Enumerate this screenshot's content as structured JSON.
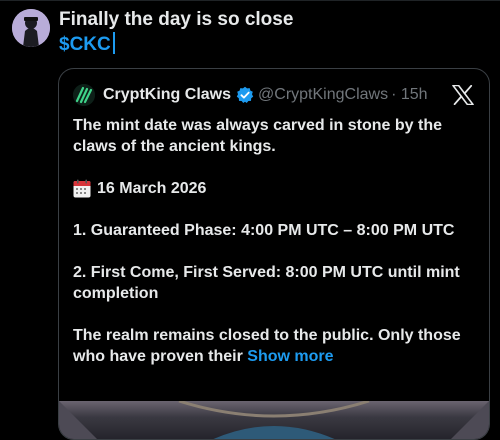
{
  "compose": {
    "line1": "Finally the day is so close",
    "line2": "$CKC"
  },
  "quote": {
    "name": "CryptKing Claws",
    "handle": "@CryptKingClaws",
    "time": "· 15h",
    "body": {
      "p1": "The mint date was always carved in stone by the claws of the ancient kings.",
      "date": "16 March 2026",
      "phase1": "1. Guaranteed Phase: 4:00 PM UTC – 8:00 PM UTC",
      "phase2": "2. First Come, First Served: 8:00 PM UTC until mint completion",
      "p4": "The realm remains closed to the public. Only those who have proven their",
      "show_more": "Show more"
    }
  },
  "colors": {
    "background": "#000000",
    "text": "#e7e9ea",
    "accent": "#1d9bf0",
    "muted": "#71767b",
    "border": "#3a3f44"
  },
  "icons": {
    "avatar": "user-avatar",
    "quote_avatar": "cryptking-avatar",
    "verified": "verified-badge-icon",
    "close": "x-close-icon",
    "calendar": "calendar-emoji-icon"
  }
}
